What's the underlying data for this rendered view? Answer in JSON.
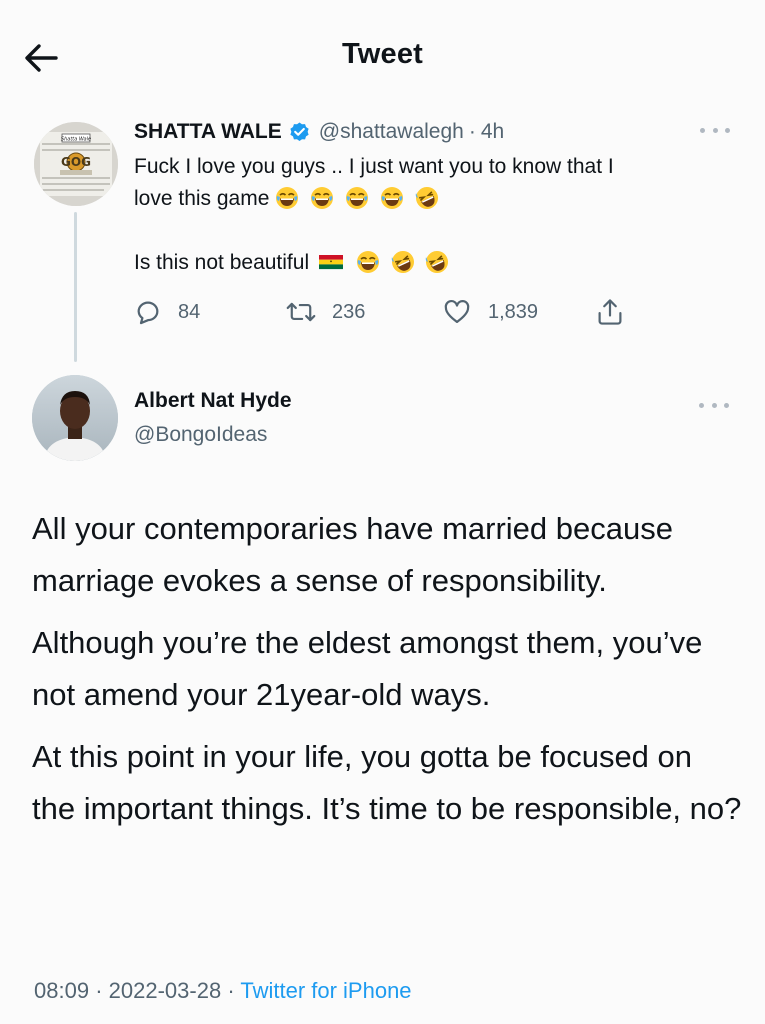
{
  "header": {
    "title": "Tweet",
    "back_icon": "arrow-left-icon"
  },
  "parent_tweet": {
    "name": "SHATTA WALE",
    "handle": "@shattawalegh",
    "separator": "·",
    "time": "4h",
    "text_line1": "Fuck I love you guys .. I just want you to know that I",
    "text_line2": "love this game",
    "text_line3": "Is this not beautiful",
    "avatar_text": "Shatta Wale",
    "avatar_logo": "GOG",
    "stats": {
      "replies": "84",
      "retweets": "236",
      "likes": "1,839"
    }
  },
  "main_tweet": {
    "name": "Albert Nat Hyde",
    "handle": "@BongoIdeas",
    "paragraphs": [
      "All your contemporaries have married because marriage evokes a sense of responsibility.",
      "Although you’re the eldest amongst them, you’ve not amend your 21year-old ways.",
      "At this point in your life, you gotta be focused on the important things. It’s time to be responsible, no?"
    ],
    "time": "08:09",
    "separator1": "·",
    "date": "2022-03-28",
    "separator2": "·",
    "source": "Twitter for iPhone"
  },
  "colors": {
    "accent": "#1d9bf0",
    "muted": "#536471",
    "text": "#0f1419"
  }
}
